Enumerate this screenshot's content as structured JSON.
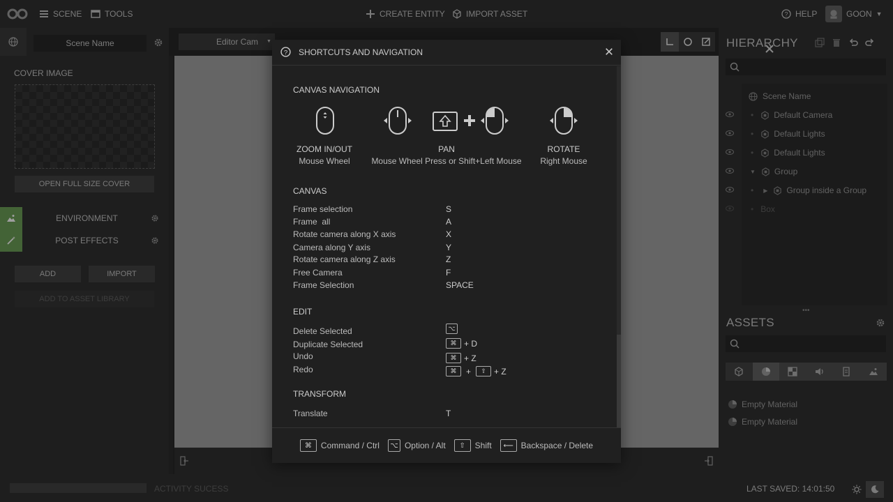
{
  "topbar": {
    "scene_label": "SCENE",
    "tools_label": "TOOLS",
    "create_entity": "CREATE ENTITY",
    "import_asset": "IMPORT ASSET",
    "help": "HELP",
    "user": "GOON"
  },
  "left_panel": {
    "scene_name": "Scene Name",
    "cover_title": "COVER IMAGE",
    "open_cover": "OPEN FULL SIZE COVER",
    "environment": "ENVIRONMENT",
    "post_effects": "POST EFFECTS",
    "add": "ADD",
    "import": "IMPORT",
    "add_to_library": "ADD TO ASSET LIBRARY"
  },
  "canvas": {
    "camera": "Editor Cam"
  },
  "hierarchy": {
    "title": "HIERARCHY",
    "items": [
      {
        "label": "Scene Name"
      },
      {
        "label": "Default Camera"
      },
      {
        "label": "Default Lights"
      },
      {
        "label": "Default Lights"
      },
      {
        "label": "Group"
      },
      {
        "label": "Group inside a Group"
      },
      {
        "label": "Box"
      }
    ]
  },
  "assets": {
    "title": "ASSETS",
    "items": [
      {
        "label": "Empty Material"
      },
      {
        "label": "Empty Material"
      }
    ]
  },
  "status": {
    "activity": "ACTIVITY SUCESS",
    "last_saved": "LAST SAVED: 14:01:50"
  },
  "modal": {
    "title": "SHORTCUTS AND NAVIGATION",
    "nav_title": "CANVAS NAVIGATION",
    "nav": [
      {
        "label": "ZOOM IN/OUT",
        "sub": "Mouse Wheel"
      },
      {
        "label": "PAN",
        "sub": "Mouse Wheel Press or Shift+Left Mouse"
      },
      {
        "label": "ROTATE",
        "sub": "Right Mouse"
      }
    ],
    "canvas_title": "CANVAS",
    "canvas_rows": [
      {
        "action": "Frame selection",
        "key": "S"
      },
      {
        "action": "Frame  all",
        "key": "A"
      },
      {
        "action": "Rotate camera along X axis",
        "key": "X"
      },
      {
        "action": "Camera along Y axis",
        "key": "Y"
      },
      {
        "action": "Rotate camera along Z axis",
        "key": "Z"
      },
      {
        "action": "Free Camera",
        "key": "F"
      },
      {
        "action": "Frame Selection",
        "key": "SPACE"
      }
    ],
    "edit_title": "EDIT",
    "edit_rows": [
      {
        "action": "Delete Selected"
      },
      {
        "action": "Duplicate Selected",
        "suffix": "+ D"
      },
      {
        "action": "Undo",
        "suffix": "+ Z"
      },
      {
        "action": "Redo",
        "plus": "+",
        "suffix": "+ Z"
      }
    ],
    "transform_title": "TRANSFORM",
    "transform_rows": [
      {
        "action": "Translate",
        "key": "T"
      }
    ],
    "legend": {
      "command": "Command / Ctrl",
      "option": "Option / Alt",
      "shift": "Shift",
      "backspace": "Backspace / Delete"
    }
  }
}
